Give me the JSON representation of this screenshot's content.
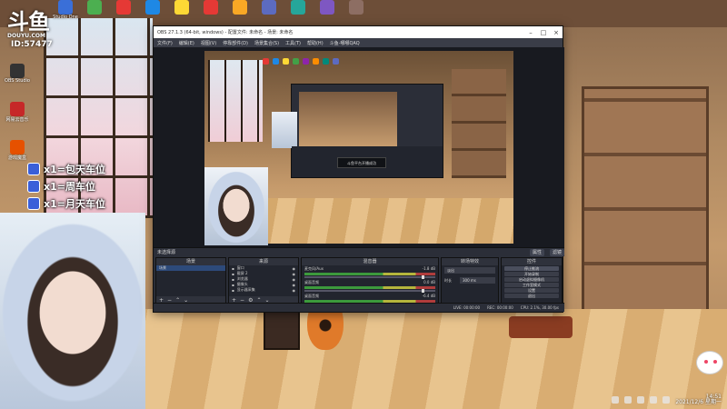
{
  "douyu": {
    "logo": "斗鱼",
    "brand": "DOUYU.COM",
    "room_id": "ID:57477"
  },
  "desktop_icons_top": [
    {
      "label": "Studio One",
      "color": "#3a6fd8"
    },
    {
      "label": "",
      "color": "#4caf50"
    },
    {
      "label": "",
      "color": "#e53935"
    },
    {
      "label": "",
      "color": "#1e88e5"
    },
    {
      "label": "",
      "color": "#fdd835"
    },
    {
      "label": "",
      "color": "#e53935"
    },
    {
      "label": "",
      "color": "#f9a825"
    },
    {
      "label": "",
      "color": "#5c6bc0"
    },
    {
      "label": "",
      "color": "#26a69a"
    },
    {
      "label": "",
      "color": "#7e57c2"
    },
    {
      "label": "",
      "color": "#8d6e63"
    }
  ],
  "desktop_icons_left": [
    {
      "label": "OBS Studio",
      "color": "#333333"
    },
    {
      "label": "网易云音乐",
      "color": "#c62828"
    },
    {
      "label": "游戏魔盒",
      "color": "#e65100"
    }
  ],
  "gifts": [
    {
      "text": "x1=包天车位"
    },
    {
      "text": "x1=周车位"
    },
    {
      "text": "x1=月天车位"
    }
  ],
  "obs": {
    "title": "OBS 27.1.3 (64-bit, windows) - 配置文件: 未命名 - 场景: 未命名",
    "menu": [
      "文件(F)",
      "编辑(E)",
      "视图(V)",
      "停靠部件(D)",
      "场景集合(S)",
      "工具(T)",
      "帮助(H)",
      "斗鱼-哪哪QAQ"
    ],
    "nested_popup": "斗鱼平台开播成功",
    "scene_bar": {
      "label": "未选择源",
      "props": "属性",
      "filters": "滤镜"
    },
    "docks": {
      "scenes": {
        "title": "场景",
        "items": [
          "场景"
        ]
      },
      "sources": {
        "title": "来源",
        "items": [
          "窗口",
          "截屏 2",
          "浏览器",
          "摄像头",
          "显示器采集"
        ]
      },
      "mixer": {
        "title": "混音器",
        "channels": [
          {
            "name": "麦克风/Aux",
            "db": "-1.8 dB"
          },
          {
            "name": "桌面音频",
            "db": "0.0 dB"
          },
          {
            "name": "桌面音频",
            "db": "-6.4 dB"
          }
        ]
      },
      "transitions": {
        "title": "转场特效",
        "type": "淡出",
        "duration_label": "时长",
        "duration": "300 ms"
      },
      "controls": {
        "title": "控件",
        "buttons": [
          "停止推流",
          "开始录制",
          "启动虚拟摄像机",
          "工作室模式",
          "设置",
          "退出"
        ]
      }
    },
    "status": [
      "LIVE: 00:00:00",
      "REC: 00:00:00",
      "CPU: 2.1%, 30.00 fps"
    ]
  },
  "clock": {
    "time": "14:51",
    "date": "2021/12/6 星期一"
  }
}
